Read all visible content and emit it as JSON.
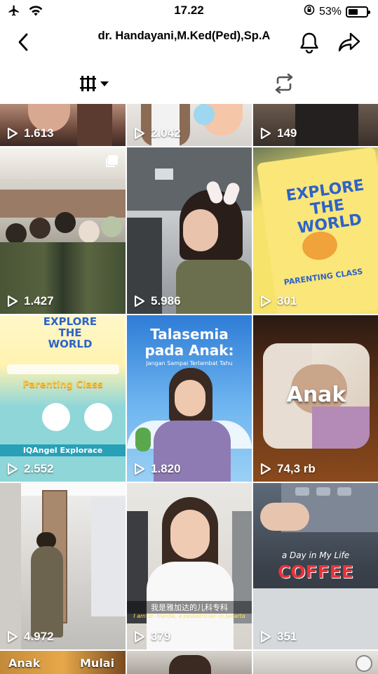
{
  "status_bar": {
    "time": "17.22",
    "battery_percent": "53%",
    "battery_level": 0.53
  },
  "header": {
    "title": "dr. Handayani,M.Ked(Ped),Sp.A"
  },
  "grid": {
    "tiles": [
      {
        "views": "1.613"
      },
      {
        "views": "2.042"
      },
      {
        "views": "149"
      },
      {
        "views": "1.427"
      },
      {
        "views": "5.986"
      },
      {
        "views": "301"
      },
      {
        "views": "2.552"
      },
      {
        "views": "1.820"
      },
      {
        "views": "74,3 rb"
      },
      {
        "views": "4.972"
      },
      {
        "views": "379"
      },
      {
        "views": "351"
      }
    ],
    "texts": {
      "t6_title": "EXPLORE THE WORLD",
      "t6_parenting": "Parenting Class",
      "t6_explorace": "IQAngel Explorace",
      "t7_heading": "Talasemia pada Anak:",
      "t7_sub": "Jangan Sampai Terlambat Tahu",
      "t8_overlay": "Anak",
      "t5_title": "EXPLORE THE WORLD",
      "t5_banner": "PARENTING CLASS",
      "t10_caption_cn": "我是雅加达的儿科专科",
      "t10_caption_en": "I am dr. Handa, a pediatrician in Jakarta",
      "t11_script": "a Day in My Life",
      "t11_word": "COFFEE",
      "t12_left": "Anak",
      "t12_right": "Mulai"
    }
  }
}
